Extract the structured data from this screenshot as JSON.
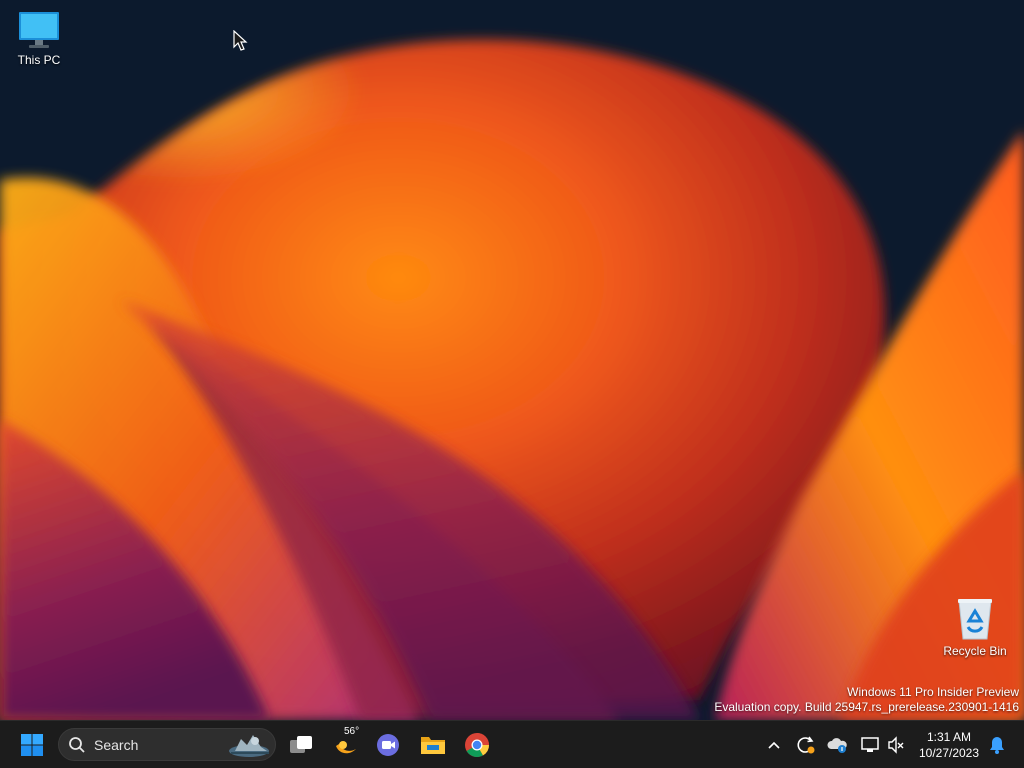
{
  "desktop": {
    "icons": [
      {
        "label": "This PC",
        "icon": "monitor-icon"
      },
      {
        "label": "Recycle Bin",
        "icon": "recycle-bin-icon"
      }
    ],
    "watermark": {
      "line1": "Windows 11 Pro Insider Preview",
      "line2": "Evaluation copy. Build 25947.rs_prerelease.230901-1416"
    }
  },
  "taskbar": {
    "search_label": "Search",
    "weather_temp": "56°",
    "pinned": [
      "task-view-icon",
      "widgets-icon",
      "teams-icon",
      "file-explorer-icon",
      "chrome-icon"
    ],
    "tray": [
      "chevron-up-icon",
      "update-icon",
      "onedrive-icon",
      "network-icon",
      "volume-muted-icon",
      "bell-icon"
    ],
    "clock": {
      "time": "1:31 AM",
      "date": "10/27/2023"
    }
  },
  "colors": {
    "taskbar_bg": "#1c1c1c",
    "accent": "#0078d4",
    "wallpaper_orange": "#f07a12"
  }
}
